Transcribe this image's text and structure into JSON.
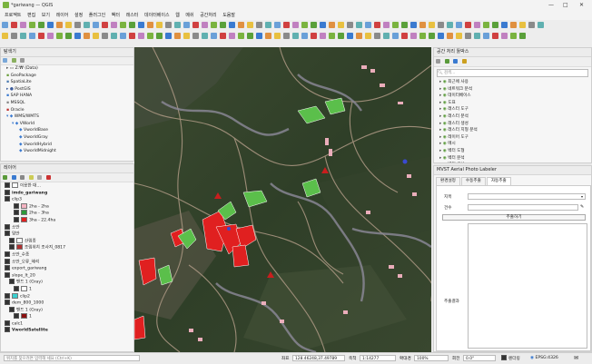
{
  "window": {
    "title": "*gariwang — QGIS"
  },
  "menu": [
    "프로젝트",
    "편집",
    "보기",
    "레이어",
    "설정",
    "플러그인",
    "벡터",
    "래스터",
    "데이터베이스",
    "웹",
    "메쉬",
    "공간처리",
    "도움말"
  ],
  "browser": {
    "title": "탐색기",
    "items": [
      "Z:₩ (Data)",
      "GeoPackage",
      "SpatiaLite",
      "PostGIS",
      "SAP HANA",
      "MSSQL",
      "Oracle",
      "WMS/WMTS",
      "VWorld",
      "VworldBase",
      "VworldGray",
      "VworldHybrid",
      "VworldMidnight"
    ]
  },
  "layers": {
    "title": "레이어",
    "items": [
      {
        "label": "이용한 대…",
        "color": "#ffffff"
      },
      {
        "label": "imdo_gariwang",
        "bold": true,
        "color": ""
      },
      {
        "label": "clip3",
        "color": ""
      },
      {
        "label": "2ha - 2ha",
        "color": "#f4b3c2"
      },
      {
        "label": "2ha - 3ha",
        "color": "#2e9a3a"
      },
      {
        "label": "3ha - 22.4ha",
        "color": "#e02020"
      },
      {
        "label": "소반",
        "color": ""
      },
      {
        "label": "임반",
        "color": ""
      },
      {
        "label": "산림종",
        "color": "#ffffff"
      },
      {
        "label": "조림위치 조사지_0817",
        "color": "#b03030"
      },
      {
        "label": "소반_수종",
        "color": ""
      },
      {
        "label": "소반_오류_해석",
        "color": ""
      },
      {
        "label": "export_gariwang",
        "color": ""
      },
      {
        "label": "slope_lt_20",
        "color": ""
      },
      {
        "label": "밴드 1 (Gray)",
        "color": ""
      },
      {
        "label": "1",
        "color": "#ffffff"
      },
      {
        "label": "clip2",
        "color": "#3ad0d0"
      },
      {
        "label": "dem_800_1000",
        "color": ""
      },
      {
        "label": "밴드 1 (Gray)",
        "color": ""
      },
      {
        "label": "1",
        "color": "#8a1010"
      },
      {
        "label": "calc1",
        "color": ""
      },
      {
        "label": "VworldSatellite",
        "bold": true,
        "color": ""
      }
    ]
  },
  "processing": {
    "title": "공간 처리 툴박스",
    "search_placeholder": "검색...",
    "items": [
      "최근에 사용",
      "네트워크 분석",
      "데이터베이스",
      "도표",
      "래스터 도구",
      "래스터 분석",
      "래스터 생성",
      "래스터 지형 분석",
      "레이어 도구",
      "메시",
      "벡터 도형",
      "벡터 분석",
      "벡터 생성"
    ]
  },
  "plugin": {
    "title": "MVST Aerial Photo Labeler",
    "tabs": [
      "환경설정",
      "수동추출",
      "자동추출"
    ],
    "field_label_1": "지목",
    "field_label_2": "건수",
    "extract_button": "추출하기",
    "result_label": "추출결과"
  },
  "status": {
    "search_placeholder": "위치를 찾으려면 입력해 세요 (Ctrl+K)",
    "coord_label": "좌표",
    "coord_value": "128.46248,37.49789",
    "scale_label": "축척",
    "scale_value": "1:14277",
    "magnifier_label": "확대경",
    "magnifier_value": "100%",
    "rotation_label": "회전",
    "rotation_value": "0.0°",
    "render_label": "렌더링",
    "crs": "EPSG:4326"
  },
  "colors": {
    "accent": "#7ab33f",
    "red": "#e02020",
    "green": "#2e9a3a",
    "pink": "#f4b3c2"
  }
}
